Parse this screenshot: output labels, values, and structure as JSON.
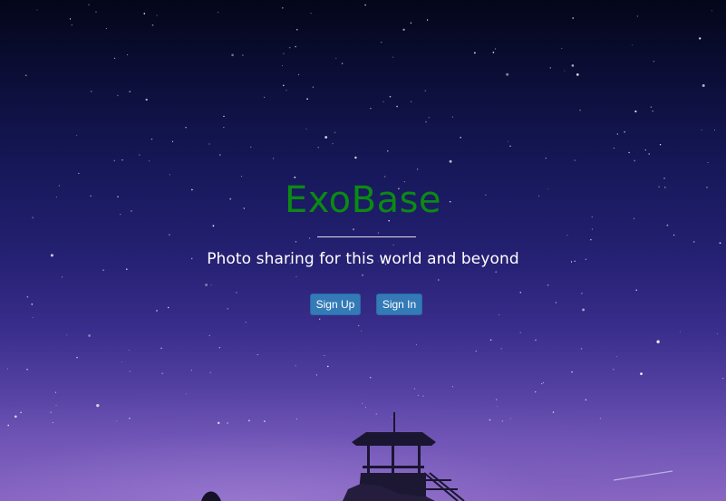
{
  "hero": {
    "title": "ExoBase",
    "tagline": "Photo sharing for this world and beyond"
  },
  "actions": {
    "sign_up_label": "Sign Up",
    "sign_in_label": "Sign In"
  },
  "colors": {
    "title": "#0b8a13",
    "button": "#337ab7",
    "tagline": "#ffffff"
  }
}
